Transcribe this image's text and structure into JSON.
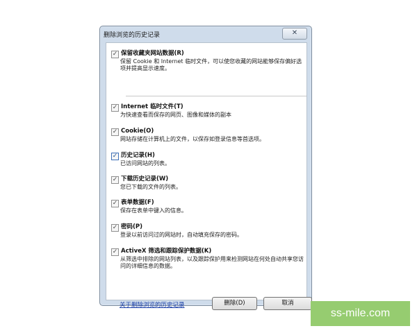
{
  "window": {
    "title": "删除浏览的历史记录",
    "close_symbol": "✕"
  },
  "items": [
    {
      "label": "保留收藏夹网站数据(R)",
      "checked": true,
      "description": "保留 Cookie 和 Internet 临时文件，可以使您收藏的网站能够保存偏好选项并提高显示速度。"
    },
    {
      "label": "Internet 临时文件(T)",
      "checked": true,
      "description": "为快速查看而保存的网页、图像和媒体的副本"
    },
    {
      "label": "Cookie(O)",
      "checked": true,
      "description": "网站存储在计算机上的文件，以保存如登录信息等首选项。"
    },
    {
      "label": "历史记录(H)",
      "checked": true,
      "description": "已访问网站的列表。"
    },
    {
      "label": "下载历史记录(W)",
      "checked": true,
      "description": "您已下载的文件的列表。"
    },
    {
      "label": "表单数据(F)",
      "checked": true,
      "description": "保存在表单中键入的信息。"
    },
    {
      "label": "密码(P)",
      "checked": true,
      "description": "登录以前访问过的网站时，自动填充保存的密码。"
    },
    {
      "label": "ActiveX 筛选和跟踪保护数据(K)",
      "checked": true,
      "description": "从筛选中排除的网站列表，以及跟踪保护用来检测网站在何处自动共享您访问的详细信息的数据。"
    }
  ],
  "footer": {
    "link_text": "关于删除浏览的历史记录",
    "delete_label": "删除(D)",
    "cancel_label": "取消"
  },
  "watermark": "ss-mile.com",
  "colors": {
    "dialog_frame": "#cfdceb",
    "link": "#1a3fa8",
    "watermark_bg": "#96cc70"
  }
}
